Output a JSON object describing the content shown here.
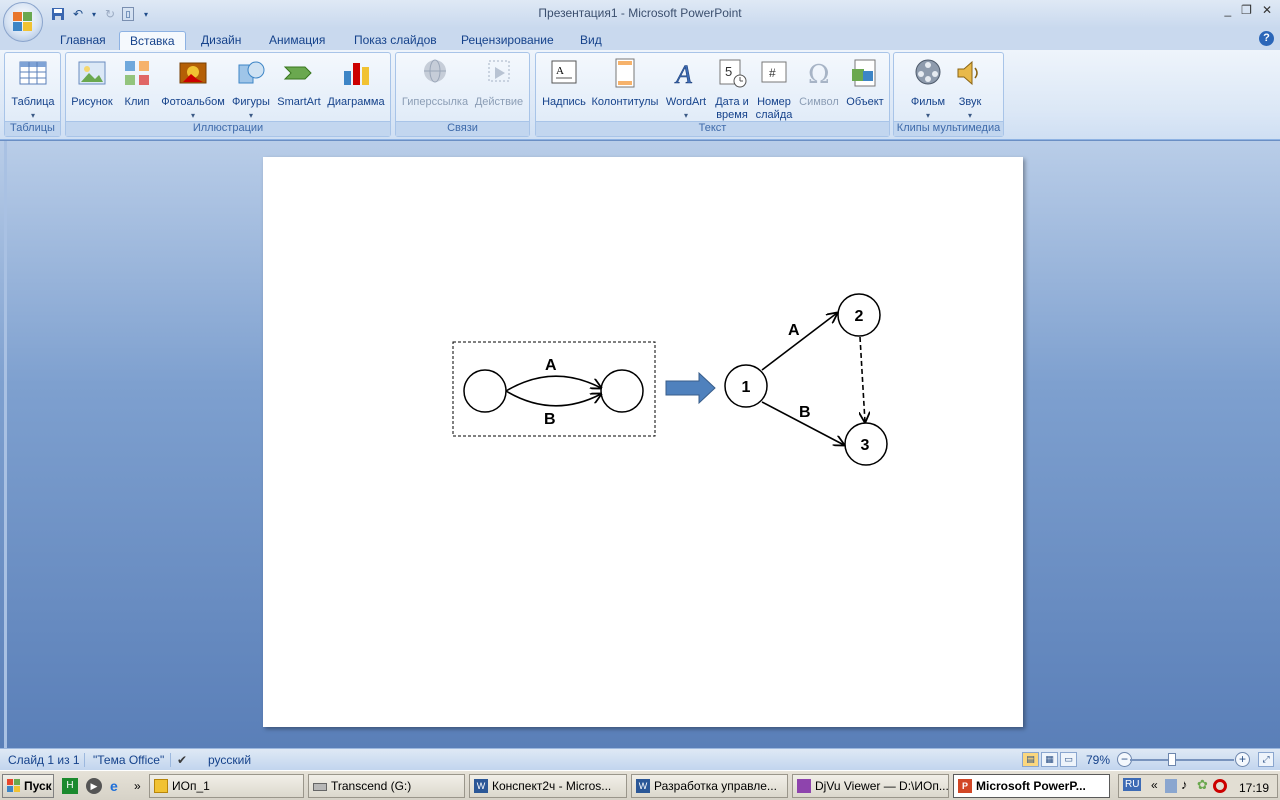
{
  "window": {
    "title": "Презентация1 - Microsoft PowerPoint",
    "controls": [
      "_",
      "❐",
      "✕"
    ]
  },
  "tabs": [
    "Главная",
    "Вставка",
    "Дизайн",
    "Анимация",
    "Показ слайдов",
    "Рецензирование",
    "Вид"
  ],
  "active_tab": "Вставка",
  "ribbon": {
    "groups": {
      "tables": "Таблицы",
      "illustrations": "Иллюстрации",
      "links": "Связи",
      "text": "Текст",
      "media": "Клипы мультимедиа"
    },
    "buttons": {
      "table": "Таблица",
      "picture": "Рисунок",
      "clip": "Клип",
      "photoalbum": "Фотоальбом",
      "shapes": "Фигуры",
      "smartart": "SmartArt",
      "chart": "Диаграмма",
      "hyperlink": "Гиперссылка",
      "action": "Действие",
      "textbox": "Надпись",
      "headerfooter": "Колонтитулы",
      "wordart": "WordArt",
      "datetime_1": "Дата и",
      "datetime_2": "время",
      "slidenum_1": "Номер",
      "slidenum_2": "слайда",
      "symbol": "Символ",
      "object": "Объект",
      "movie": "Фильм",
      "sound": "Звук"
    }
  },
  "slide": {
    "left_edge_top": "A",
    "left_edge_bottom": "B",
    "node1": "1",
    "node2": "2",
    "node3": "3",
    "edge_a": "A",
    "edge_b": "B"
  },
  "status": {
    "slide": "Слайд 1 из 1",
    "theme": "\"Тема Office\"",
    "lang": "русский",
    "zoom": "79%"
  },
  "taskbar": {
    "start": "Пуск",
    "tasks": [
      "ИОп_1",
      "Transcend (G:)",
      "Конспект2ч - Micros...",
      "Разработка управле...",
      "DjVu Viewer — D:\\ИОп...",
      "Microsoft PowerP..."
    ],
    "lang": "RU",
    "clock": "17:19"
  },
  "colors": {
    "accent": "#15428b",
    "slide_bg": "#ffffff",
    "arrow_fill": "#4f81bd"
  }
}
